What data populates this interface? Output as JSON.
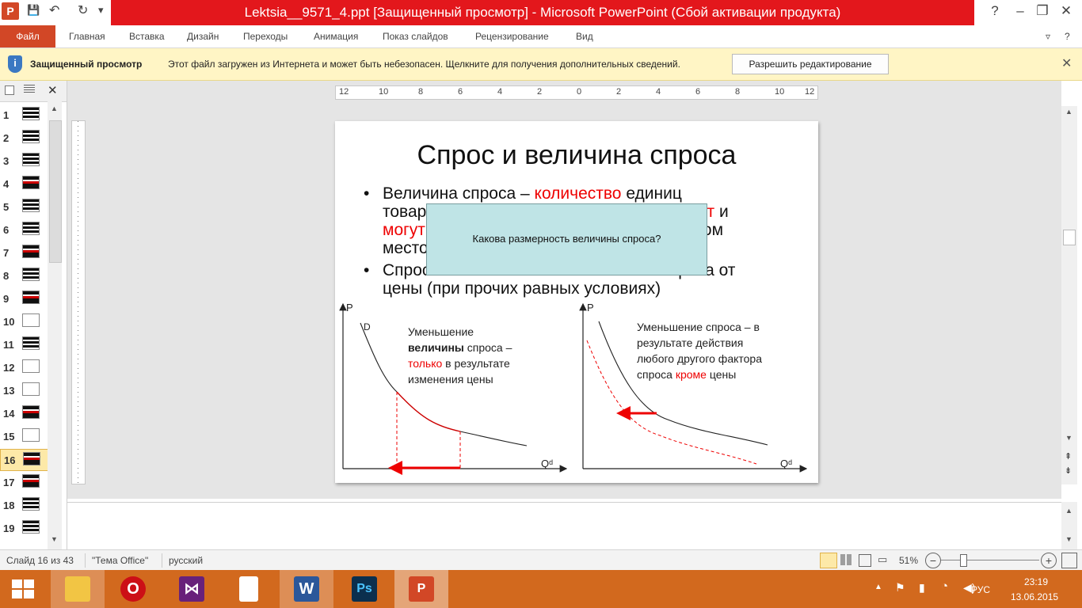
{
  "window": {
    "title": "Lektsia__9571_4.ppt [Защищенный просмотр] - Microsoft PowerPoint (Сбой активации продукта)",
    "app_badge": "P",
    "minimize": "–",
    "restore": "❐",
    "close": "✕",
    "help": "?"
  },
  "quick_access": {
    "save_icon": "💾",
    "undo_icon": "↶",
    "redo_icon": "↻",
    "customize_icon": "▾"
  },
  "ribbon": {
    "file_tab": "Файл",
    "tabs": [
      "Главная",
      "Вставка",
      "Дизайн",
      "Переходы",
      "Анимация",
      "Показ слайдов",
      "Рецензирование",
      "Вид"
    ],
    "collapse_icon": "▿"
  },
  "message_bar": {
    "icon": "shield-icon",
    "title": "Защищенный просмотр",
    "text": "Этот файл загружен из Интернета и может быть небезопасен. Щелкните для получения дополнительных сведений.",
    "button": "Разрешить редактирование",
    "close": "✕"
  },
  "thumbnails": {
    "close": "✕",
    "items": [
      "1",
      "2",
      "3",
      "4",
      "5",
      "6",
      "7",
      "8",
      "9",
      "10",
      "11",
      "12",
      "13",
      "14",
      "15",
      "16",
      "17",
      "18",
      "19"
    ],
    "active_index": 15
  },
  "ruler": {
    "labels": [
      "12",
      "10",
      "8",
      "6",
      "4",
      "2",
      "0",
      "2",
      "4",
      "6",
      "8",
      "10",
      "12"
    ]
  },
  "slide": {
    "title": "Спрос и величина спроса",
    "bullet1": {
      "part1": "Величина спроса – ",
      "red1": "количество",
      "part2": " единиц",
      "line2a": "товар",
      "line2red": "отят",
      "line2b": " и",
      "line3red": "могут",
      "line3b": "ом",
      "line4": "место"
    },
    "bullet2": {
      "part1": "Спрос",
      "line1end": "ы спроса от",
      "line2": "цены (при прочих равных условиях)"
    },
    "bullet_dot": "•",
    "callout": "Какова размерность величины спроса?",
    "left_chart": {
      "y_label": "P",
      "x_label": "Qᵈ",
      "curve_label": "D",
      "caption_l1": "Уменьшение",
      "caption_l2_bold": "величины",
      "caption_l2_rest": " спроса –",
      "caption_l3_red": "только",
      "caption_l3_rest": " в результате",
      "caption_l4": "изменения  цены"
    },
    "right_chart": {
      "y_label": "P",
      "x_label": "Qᵈ",
      "caption_l1": "Уменьшение   спроса – в",
      "caption_l2": "результате действия",
      "caption_l3": "любого другого фактора",
      "caption_l4a": "спроса ",
      "caption_l4_red": "кроме",
      "caption_l4b": "  цены"
    }
  },
  "statusbar": {
    "slide_info": "Слайд 16 из 43",
    "theme": "\"Тема Office\"",
    "language": "русский",
    "zoom": "51%",
    "zoom_level": 0.51,
    "zoom_minus": "−",
    "zoom_plus": "+"
  },
  "taskbar": {
    "apps": [
      "file-explorer-icon",
      "opera-icon",
      "visual-studio-icon",
      "blank-document-icon",
      "word-icon",
      "photoshop-icon",
      "powerpoint-icon"
    ],
    "word_label": "W",
    "ps_label": "Ps",
    "opera_label": "O",
    "tray_lang": "РУС",
    "time": "23:19",
    "date": "13.06.2015"
  },
  "colors": {
    "accent": "#d24726",
    "title_bar": "#e3171c",
    "taskbar": "#d2691e",
    "message_bar": "#fff5c5",
    "callout": "#bfe4e6",
    "highlight_red": "#e00000"
  }
}
